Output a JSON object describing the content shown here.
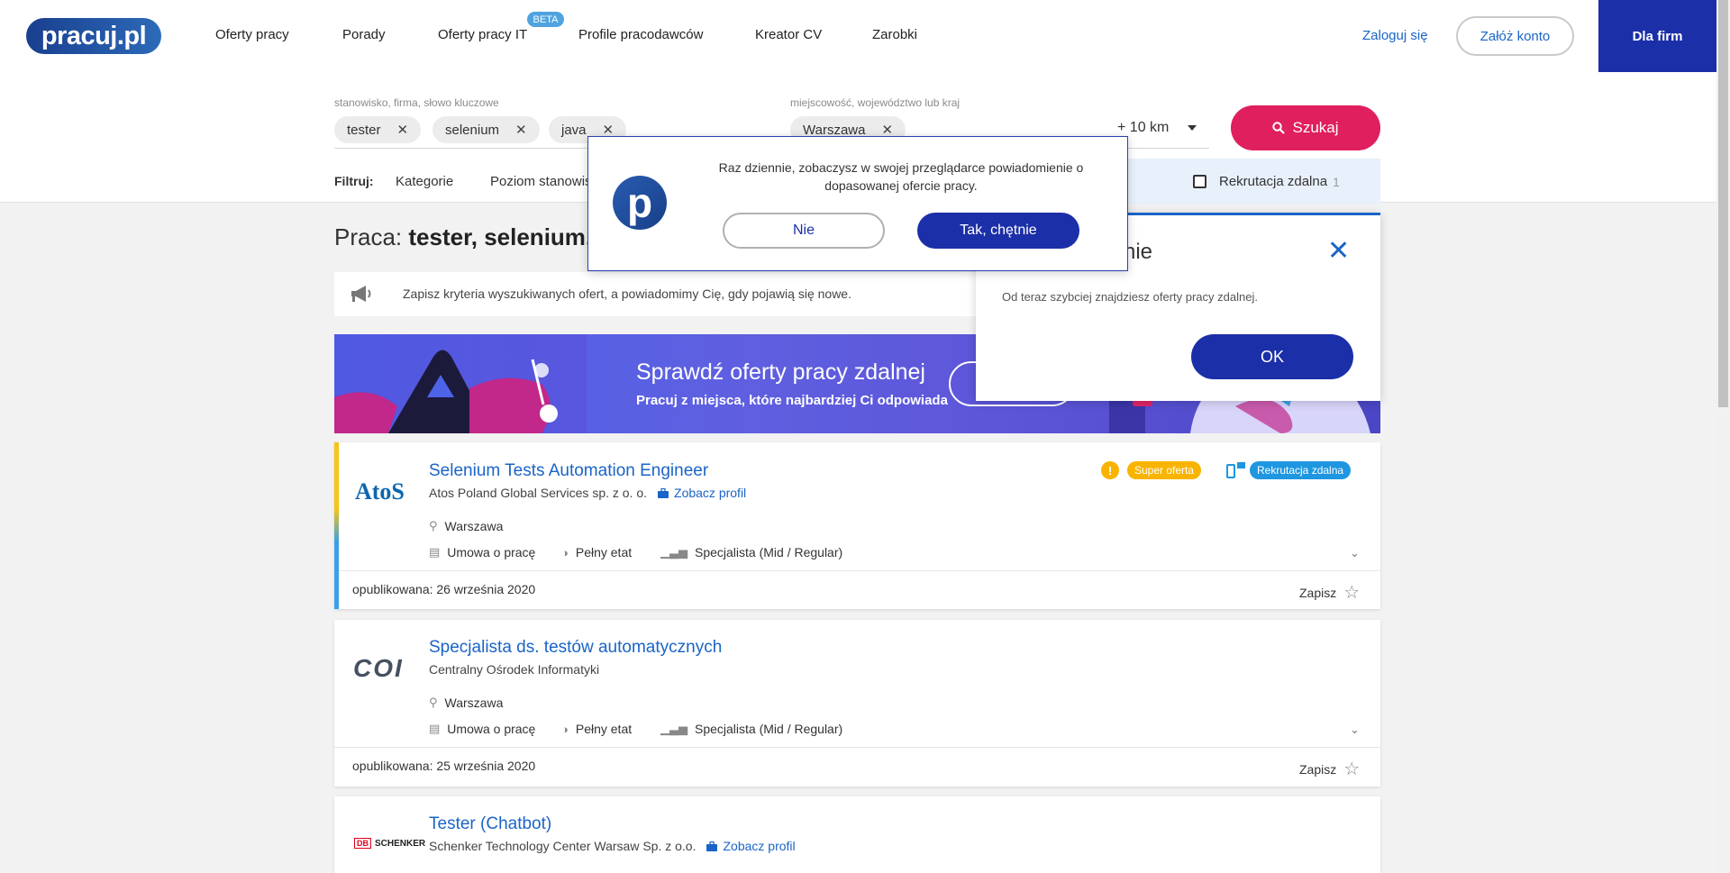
{
  "header": {
    "logo": "pracuj.pl",
    "nav": [
      "Oferty pracy",
      "Porady",
      "Oferty pracy IT",
      "Profile pracodawców",
      "Kreator CV",
      "Zarobki"
    ],
    "beta_badge": "BETA",
    "login": "Zaloguj się",
    "register": "Załóż konto",
    "for_companies": "Dla firm"
  },
  "search": {
    "keyword_label": "stanowisko, firma, słowo kluczowe",
    "keywords": [
      "tester",
      "selenium",
      "java"
    ],
    "location_label": "miejscowość, województwo lub kraj",
    "location": "Warszawa",
    "radius": "+ 10 km",
    "button": "Szukaj"
  },
  "filters": {
    "label": "Filtruj:",
    "items": [
      "Kategorie",
      "Poziom stanowiska"
    ],
    "hidden_count": "1",
    "remote_label": "Rekrutacja zdalna",
    "remote_count": "1"
  },
  "page_title": {
    "prefix": "Praca: ",
    "query": "tester, selenium, java"
  },
  "save_search": {
    "text": "Zapisz kryteria wyszukiwanych ofert, a powiadomimy Cię, gdy pojawią się nowe."
  },
  "banner": {
    "title": "Sprawdź oferty pracy zdalnej",
    "subtitle": "Pracuj z miejsca, które najbardziej Ci odpowiada"
  },
  "jobs": [
    {
      "logo": "AtoS",
      "title": "Selenium Tests Automation Engineer",
      "company": "Atos Poland Global Services sp. z o. o.",
      "profile_link": "Zobacz profil",
      "location": "Warszawa",
      "contract": "Umowa o pracę",
      "time": "Pełny etat",
      "level": "Specjalista (Mid / Regular)",
      "published": "opublikowana: 26 września 2020",
      "save": "Zapisz",
      "badge_super": "Super oferta",
      "badge_remote": "Rekrutacja zdalna"
    },
    {
      "logo": "COI",
      "title": "Specjalista ds. testów automatycznych",
      "company": "Centralny Ośrodek Informatyki",
      "location": "Warszawa",
      "contract": "Umowa o pracę",
      "time": "Pełny etat",
      "level": "Specjalista (Mid / Regular)",
      "published": "opublikowana: 25 września 2020",
      "save": "Zapisz"
    },
    {
      "logo": "DB SCHENKER",
      "title": "Tester (Chatbot)",
      "company": "Schenker Technology Center Warsaw Sp. z o.o.",
      "profile_link": "Zobacz profil"
    }
  ],
  "remote_dialog": {
    "title_fragment": "nie",
    "body": "Od teraz szybciej znajdziesz oferty pracy zdalnej.",
    "ok": "OK"
  },
  "push_modal": {
    "text": "Raz dziennie, zobaczysz w swojej przeglądarce powiadomienie o dopasowanej ofercie pracy.",
    "no": "Nie",
    "yes": "Tak, chętnie"
  }
}
